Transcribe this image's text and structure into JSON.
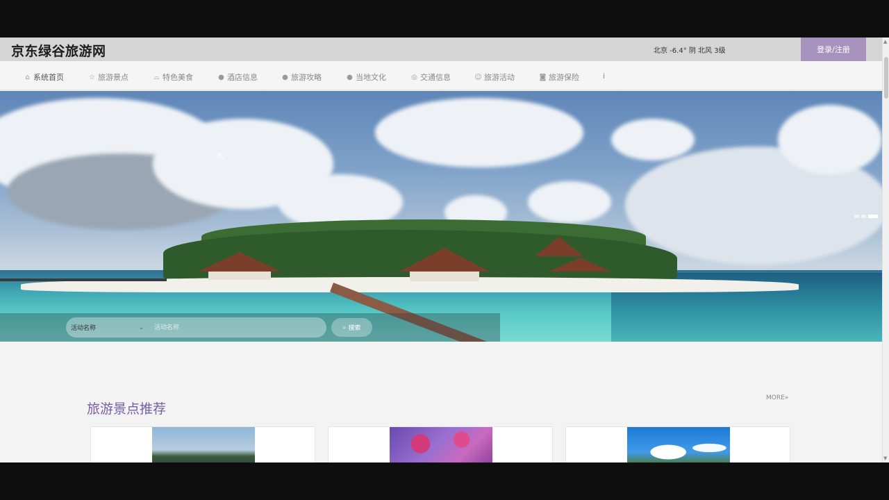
{
  "header": {
    "site_title": "京东绿谷旅游网",
    "weather": "北京  -6.4°  阴  北风  3级",
    "login_label": "登录/注册"
  },
  "nav": {
    "items": [
      {
        "label": "系统首页",
        "icon": "home-icon"
      },
      {
        "label": "旅游景点",
        "icon": "star-icon"
      },
      {
        "label": "特色美食",
        "icon": "bag-icon"
      },
      {
        "label": "酒店信息",
        "icon": "info-icon"
      },
      {
        "label": "旅游攻略",
        "icon": "question-icon"
      },
      {
        "label": "当地文化",
        "icon": "info-icon"
      },
      {
        "label": "交通信息",
        "icon": "compass-icon"
      },
      {
        "label": "旅游活动",
        "icon": "smile-icon"
      },
      {
        "label": "旅游保险",
        "icon": "camera-icon"
      },
      {
        "label": "i",
        "icon": ""
      }
    ]
  },
  "search": {
    "select_value": "活动名称",
    "input_placeholder": "活动名称",
    "button_label": "搜索"
  },
  "section": {
    "title": "旅游景点推荐",
    "more_label": "MORE»"
  },
  "colors": {
    "accent": "#7a5da6",
    "login_bg": "#a692bc"
  }
}
